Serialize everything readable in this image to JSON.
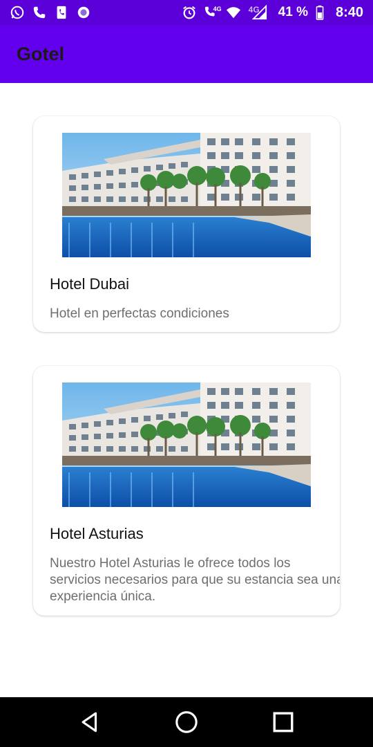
{
  "status_bar": {
    "icons_left": [
      "whatsapp-icon",
      "phone-icon",
      "phone-alt-icon",
      "circle-app-icon"
    ],
    "icons_right": [
      "alarm-icon",
      "volte-icon",
      "wifi-icon",
      "signal-icon",
      "battery-icon"
    ],
    "volte_label": "4G",
    "network_label": "4G",
    "battery_percent": "41 %",
    "time": "8:40"
  },
  "app_bar": {
    "title": "Gotel",
    "color": "#6200ee"
  },
  "hotels": [
    {
      "name": "Hotel Dubai",
      "description": "Hotel en perfectas condiciones",
      "image": "hotel-pool-image"
    },
    {
      "name": "Hotel Asturias",
      "description": "Nuestro Hotel Asturias le ofrece todos los servicios necesarios para que su estancia sea una experiencia única.",
      "image": "hotel-pool-image"
    }
  ],
  "nav_bar": {
    "buttons": [
      "back-icon",
      "home-icon",
      "recents-icon"
    ]
  }
}
